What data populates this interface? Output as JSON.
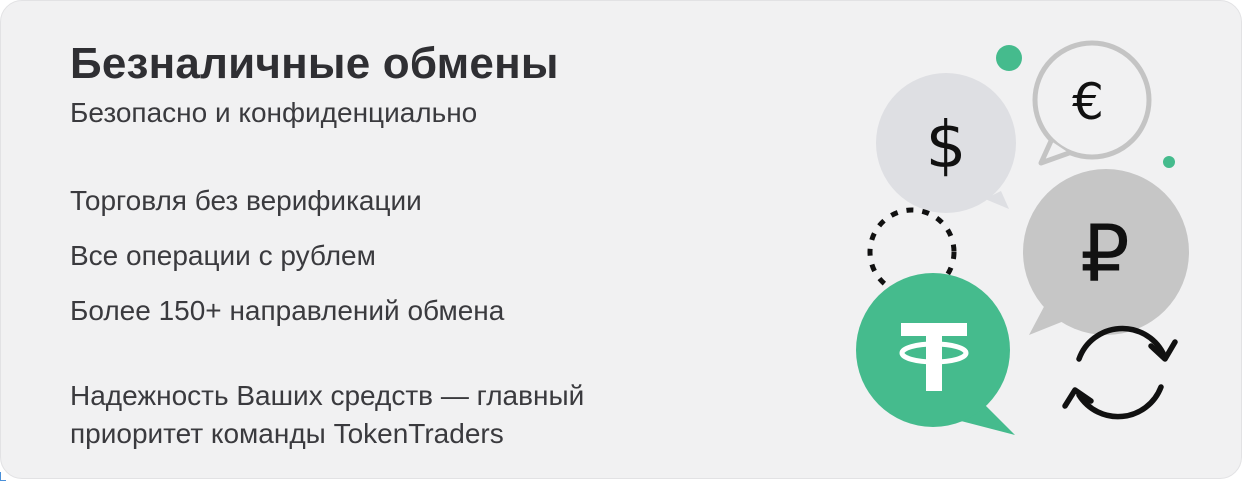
{
  "banner": {
    "title": "Безналичные обмены",
    "subtitle": "Безопасно и конфиденциально",
    "features": [
      "Торговля без верификации",
      "Все операции с рублем",
      "Более 150+ направлений обмена"
    ],
    "note_line1": "Надежность Ваших средств — главный",
    "note_line2": "приоритет команды TokenTraders"
  },
  "illustration": {
    "icons": [
      "dollar-icon",
      "euro-icon",
      "ruble-icon",
      "tether-icon",
      "exchange-arrows-icon"
    ],
    "symbols": {
      "dollar": "$",
      "euro": "€",
      "ruble": "₽"
    },
    "colors": {
      "green": "#45bb8d",
      "light_gray": "#dedfe3",
      "mid_gray": "#c6c6c6",
      "outline_gray": "#c4c4c4",
      "text_dark": "#2f2f33"
    }
  }
}
